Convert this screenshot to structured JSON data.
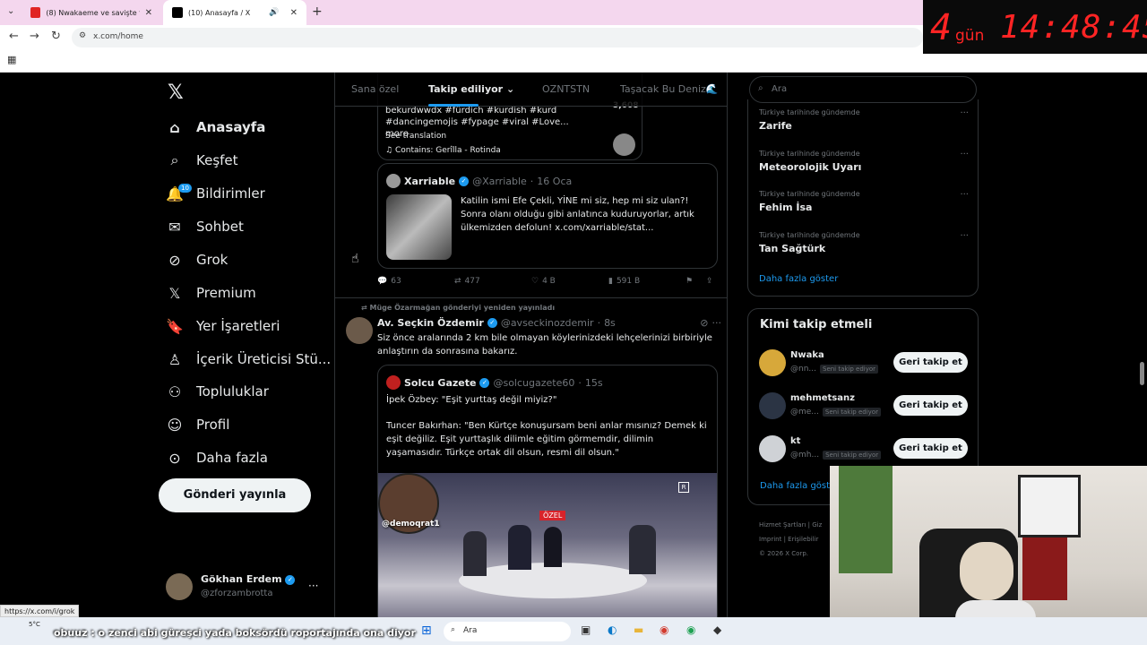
{
  "browser": {
    "tabs": [
      {
        "title": "(8) Nwakaeme ve savişte flaş gü",
        "favicon_color": "#e02424"
      },
      {
        "title": "(10) Anasayfa / X",
        "favicon_color": "#000000"
      }
    ],
    "url": "x.com/home",
    "status_url": "https://x.com/i/grok"
  },
  "timer": {
    "days": "4",
    "days_label": "gün",
    "clock": "14:48:45"
  },
  "nav": {
    "items": [
      {
        "label": "Anasayfa",
        "icon": "home-icon"
      },
      {
        "label": "Keşfet",
        "icon": "search-icon"
      },
      {
        "label": "Bildirimler",
        "icon": "bell-icon",
        "badge": "10"
      },
      {
        "label": "Sohbet",
        "icon": "mail-icon"
      },
      {
        "label": "Grok",
        "icon": "grok-icon"
      },
      {
        "label": "Premium",
        "icon": "x-icon"
      },
      {
        "label": "Yer İşaretleri",
        "icon": "bookmark-icon"
      },
      {
        "label": "İçerik Üreticisi Stü...",
        "icon": "studio-icon"
      },
      {
        "label": "Topluluklar",
        "icon": "people-icon"
      },
      {
        "label": "Profil",
        "icon": "profile-icon"
      },
      {
        "label": "Daha fazla",
        "icon": "more-icon"
      }
    ],
    "post_button": "Gönderi yayınla",
    "me": {
      "name": "Gökhan Erdem",
      "handle": "@zforzambrotta"
    }
  },
  "timeline": {
    "tabs": [
      "Sana özel",
      "Takip ediliyor",
      "OZNTSTN",
      "Taşacak Bu Deniz🌊"
    ],
    "top_card": {
      "text_line1": "bekurdwwdx #fürdich #kurdish #kurd",
      "text_line2": "#dancingemojis #fypage #viral #Love... more",
      "count": "3,608",
      "translation": "See translation",
      "contains": "Contains: Gerîlla - Rotinda"
    },
    "quote1": {
      "name": "Xarriable",
      "handle": "@Xarriable",
      "date": "16 Oca",
      "text": "Katilin ismi Efe Çekli, YİNE mi siz, hep mi siz ulan?! Sonra olanı olduğu gibi anlatınca kuduruyorlar, artık ülkemizden defolun!  x.com/xarriable/stat..."
    },
    "actions1": {
      "replies": "63",
      "reposts": "477",
      "likes": "4 B",
      "views": "591 B"
    },
    "repost_note": "Müge Özarmağan gönderiyi yeniden yayınladı",
    "post2": {
      "name": "Av. Seçkin Özdemir",
      "handle": "@avseckinozdemir",
      "time": "8s",
      "text": "Siz önce aralarında 2 km bile olmayan köylerinizdeki lehçelerinizi birbiriyle anlaştırın da sonrasına bakarız."
    },
    "quote2": {
      "name": "Solcu Gazete",
      "handle": "@solcugazete60",
      "time": "15s",
      "line1": "İpek Özbey: \"Eşit yurttaş değil miyiz?\"",
      "line2": "Tuncer Bakırhan: \"Ben Kürtçe konuşursam beni anlar mısınız? Demek ki eşit değiliz. Eşit yurttaşlık dilimle eğitim görmemdir, dilimin yaşamasıdır. Türkçe ortak dil olsun, resmi dil olsun.\"",
      "video_tag": "@demoqrat1",
      "video_badge": "ÖZEL"
    }
  },
  "right": {
    "search_placeholder": "Ara",
    "trends": [
      {
        "meta": "Türkiye tarihinde gündemde",
        "name": "Zarife"
      },
      {
        "meta": "Türkiye tarihinde gündemde",
        "name": "Meteorolojik Uyarı"
      },
      {
        "meta": "Türkiye tarihinde gündemde",
        "name": "Fehim İsa"
      },
      {
        "meta": "Türkiye tarihinde gündemde",
        "name": "Tan Sağtürk"
      }
    ],
    "show_more": "Daha fazla göster",
    "who_to_follow": {
      "title": "Kimi takip etmeli",
      "users": [
        {
          "name": "Nwaka",
          "handle": "@nn...",
          "tag": "Seni takip ediyor",
          "button": "Geri takip et"
        },
        {
          "name": "mehmetsanz",
          "handle": "@me...",
          "tag": "Seni takip ediyor",
          "button": "Geri takip et"
        },
        {
          "name": "kt",
          "handle": "@mh...",
          "tag": "Seni takip ediyor",
          "button": "Geri takip et"
        }
      ],
      "show_more": "Daha fazla göst"
    },
    "footer": {
      "line1": "Hizmet Şartları",
      "line1b": "Giz",
      "line2": "Imprint",
      "line2b": "Erişilebilir",
      "line3": "© 2026 X Corp."
    }
  },
  "taskbar": {
    "temp": "5°C",
    "search": "Ara"
  },
  "subtitle": "obuuz : o zenci abi güreşci yada boksördü roportajında ona diyor"
}
